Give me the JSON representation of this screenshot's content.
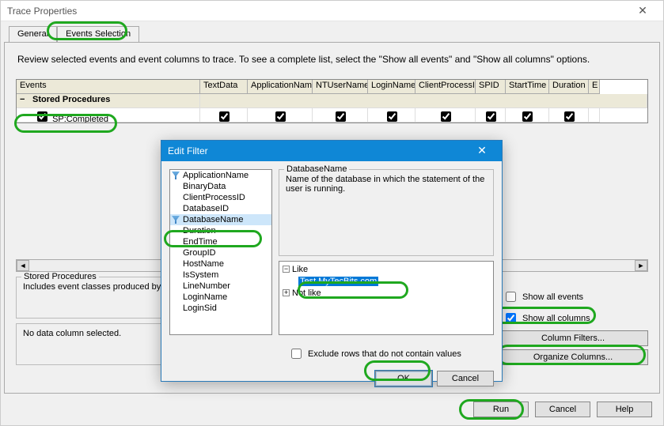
{
  "window": {
    "title": "Trace Properties"
  },
  "tabs": {
    "general": "General",
    "events": "Events Selection"
  },
  "intro": "Review selected events and event columns to trace. To see a complete list, select the \"Show all events\" and \"Show all columns\" options.",
  "columns": {
    "c0": "Events",
    "c1": "TextData",
    "c2": "ApplicationName",
    "c3": "NTUserName",
    "c4": "LoginName",
    "c5": "ClientProcessID",
    "c6": "SPID",
    "c7": "StartTime",
    "c8": "Duration",
    "c9": "E"
  },
  "rows": {
    "category": "Stored Procedures",
    "r0name": "SP:Completed"
  },
  "leftGroup": {
    "title": "Stored Procedures",
    "desc": "Includes event classes produced by"
  },
  "noDataCol": "No data column selected.",
  "checks": {
    "showAllEvents": "Show all events",
    "showAllColumns": "Show all columns"
  },
  "buttons": {
    "colFilters": "Column Filters...",
    "orgCols": "Organize Columns...",
    "run": "Run",
    "cancel": "Cancel",
    "help": "Help"
  },
  "dialog": {
    "title": "Edit Filter",
    "items": {
      "i0": "ApplicationName",
      "i1": "BinaryData",
      "i2": "ClientProcessID",
      "i3": "DatabaseID",
      "i4": "DatabaseName",
      "i5": "Duration",
      "i6": "EndTime",
      "i7": "GroupID",
      "i8": "HostName",
      "i9": "IsSystem",
      "i10": "LineNumber",
      "i11": "LoginName",
      "i12": "LoginSid"
    },
    "descTitle": "DatabaseName",
    "descText": "Name of the database in which the statement of the user is running.",
    "tree": {
      "like": "Like",
      "notlike": "Not like",
      "value": "Test.MyTecBits.com"
    },
    "exclude": "Exclude rows that do not contain values",
    "ok": "OK",
    "cancel": "Cancel"
  }
}
